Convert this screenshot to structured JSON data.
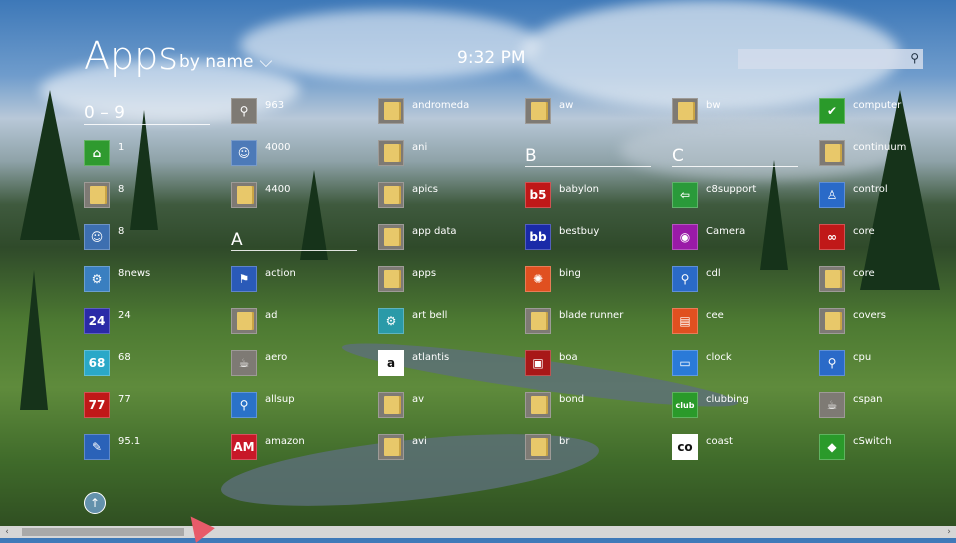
{
  "header": {
    "title": "Apps",
    "sort_label": "by name",
    "time": "9:32 PM"
  },
  "search": {
    "value": "",
    "placeholder": ""
  },
  "sections": [
    {
      "label": "0 – 9"
    },
    {
      "label": "A"
    },
    {
      "label": "B"
    },
    {
      "label": "C"
    }
  ],
  "apps": [
    {
      "label": "1",
      "icon": "grass-icon",
      "color": "#2f9a2f"
    },
    {
      "label": "8",
      "icon": "folder-icon",
      "color": ""
    },
    {
      "label": "8",
      "icon": "portrait-icon",
      "color": "#3d6fb0"
    },
    {
      "label": "8news",
      "icon": "network-icon",
      "color": "#3a7fc0"
    },
    {
      "label": "24",
      "icon": "glyph-24-icon",
      "color": "#2a2aa8"
    },
    {
      "label": "68",
      "icon": "number-68-icon",
      "color": "#2aa8c8"
    },
    {
      "label": "77",
      "icon": "number-77-icon",
      "color": "#c01818"
    },
    {
      "label": "95.1",
      "icon": "radio-icon",
      "color": "#2a62b8"
    },
    {
      "label": "963",
      "icon": "magnifier-icon",
      "color": "#7e7a74"
    },
    {
      "label": "4000",
      "icon": "portrait-icon",
      "color": "#4d7ab8"
    },
    {
      "label": "4400",
      "icon": "folder-icon",
      "color": ""
    },
    {
      "label": "action",
      "icon": "flag-icon",
      "color": "#2a5ab8"
    },
    {
      "label": "ad",
      "icon": "folder-icon",
      "color": ""
    },
    {
      "label": "aero",
      "icon": "cup-icon",
      "color": "#7e7a74"
    },
    {
      "label": "allsup",
      "icon": "pin-icon",
      "color": "#2a72c8"
    },
    {
      "label": "amazon",
      "icon": "amazon-box-icon",
      "color": "#c81828"
    },
    {
      "label": "andromeda",
      "icon": "folder-icon",
      "color": ""
    },
    {
      "label": "ani",
      "icon": "folder-icon",
      "color": ""
    },
    {
      "label": "apics",
      "icon": "folder-icon",
      "color": ""
    },
    {
      "label": "app data",
      "icon": "folder-icon",
      "color": ""
    },
    {
      "label": "apps",
      "icon": "folder-icon",
      "color": ""
    },
    {
      "label": "art bell",
      "icon": "network-icon",
      "color": "#2a9aa8"
    },
    {
      "label": "atlantis",
      "icon": "amazon-a-icon",
      "color": "#ffffff"
    },
    {
      "label": "av",
      "icon": "folder-icon",
      "color": ""
    },
    {
      "label": "avi",
      "icon": "folder-icon",
      "color": ""
    },
    {
      "label": "aw",
      "icon": "folder-icon",
      "color": ""
    },
    {
      "label": "babylon",
      "icon": "b5-icon",
      "color": "#c01818"
    },
    {
      "label": "bestbuy",
      "icon": "bb-icon",
      "color": "#1a2aa8"
    },
    {
      "label": "bing",
      "icon": "bing-icon",
      "color": "#e05020"
    },
    {
      "label": "blade runner",
      "icon": "folder-icon",
      "color": ""
    },
    {
      "label": "boa",
      "icon": "tv-icon",
      "color": "#a81818"
    },
    {
      "label": "bond",
      "icon": "folder-icon",
      "color": ""
    },
    {
      "label": "br",
      "icon": "folder-icon",
      "color": ""
    },
    {
      "label": "bw",
      "icon": "folder-icon",
      "color": ""
    },
    {
      "label": "c8support",
      "icon": "arrow-icon",
      "color": "#2a9a3a"
    },
    {
      "label": "Camera",
      "icon": "camera-icon",
      "color": "#9a1aa8"
    },
    {
      "label": "cdl",
      "icon": "magnifier-icon",
      "color": "#2a6ac8"
    },
    {
      "label": "cee",
      "icon": "basket-icon",
      "color": "#e05020"
    },
    {
      "label": "clock",
      "icon": "monitor-icon",
      "color": "#2a7ad8"
    },
    {
      "label": "clubbing",
      "icon": "club-icon",
      "color": "#2a9a2a"
    },
    {
      "label": "coast",
      "icon": "coast-icon",
      "color": "#ffffff"
    },
    {
      "label": "computer",
      "icon": "shield-icon",
      "color": "#2a9a2a"
    },
    {
      "label": "continuum",
      "icon": "folder-icon",
      "color": ""
    },
    {
      "label": "control",
      "icon": "robot-icon",
      "color": "#2a6ac8"
    },
    {
      "label": "core",
      "icon": "core-icon",
      "color": "#c01818"
    },
    {
      "label": "core",
      "icon": "folder-icon",
      "color": ""
    },
    {
      "label": "covers",
      "icon": "folder-icon",
      "color": ""
    },
    {
      "label": "cpu",
      "icon": "magnifier-icon",
      "color": "#2a6ac8"
    },
    {
      "label": "cspan",
      "icon": "cup-icon",
      "color": "#7e7a74"
    },
    {
      "label": "cSwitch",
      "icon": "cube-icon",
      "color": "#2a9a2a"
    }
  ]
}
